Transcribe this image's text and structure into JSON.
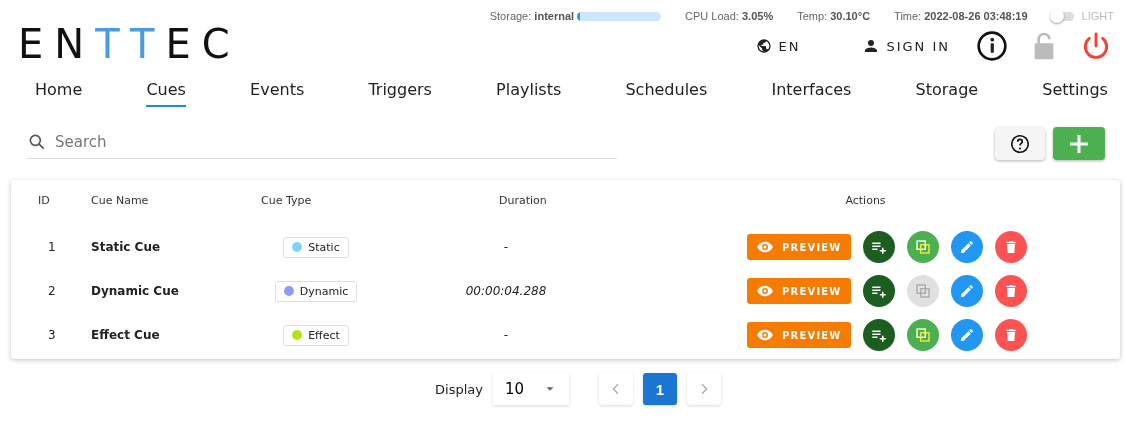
{
  "status": {
    "storage": {
      "label": "Storage:",
      "value": "internal",
      "level": 0.03
    },
    "cpu_label": "CPU Load:",
    "cpu_value": "3.05%",
    "temp_label": "Temp:",
    "temp_value": "30.10°C",
    "time_label": "Time:",
    "time_value": "2022-08-26 03:48:19",
    "theme_toggle": {
      "label": "LIGHT",
      "on": false
    }
  },
  "logo": [
    {
      "text": "EN",
      "accent": false
    },
    {
      "text": "TT",
      "accent": true
    },
    {
      "text": "EC",
      "accent": false
    }
  ],
  "header_actions": {
    "language": "EN",
    "sign_in": "SIGN IN"
  },
  "nav": [
    {
      "label": "Home",
      "selected": false
    },
    {
      "label": "Cues",
      "selected": true
    },
    {
      "label": "Events",
      "selected": false
    },
    {
      "label": "Triggers",
      "selected": false
    },
    {
      "label": "Playlists",
      "selected": false
    },
    {
      "label": "Schedules",
      "selected": false
    },
    {
      "label": "Interfaces",
      "selected": false
    },
    {
      "label": "Storage",
      "selected": false
    },
    {
      "label": "Settings",
      "selected": false
    }
  ],
  "search": {
    "placeholder": "Search"
  },
  "table": {
    "columns": [
      "ID",
      "Cue Name",
      "Cue Type",
      "Duration",
      "Actions"
    ],
    "rows": [
      {
        "id": "1",
        "name": "Static Cue",
        "type": "Static",
        "color": "#7fd3fb",
        "duration": "-",
        "preview": "PREVIEW",
        "copy_disabled": false
      },
      {
        "id": "2",
        "name": "Dynamic Cue",
        "type": "Dynamic",
        "color": "#8c9cf8",
        "duration": "00:00:04.288",
        "preview": "PREVIEW",
        "copy_disabled": true
      },
      {
        "id": "3",
        "name": "Effect Cue",
        "type": "Effect",
        "color": "#b2e314",
        "duration": "-",
        "preview": "PREVIEW",
        "copy_disabled": false
      }
    ]
  },
  "pagination": {
    "label": "Display",
    "page_size": "10",
    "pages": [
      {
        "label": "1",
        "selected": true
      }
    ]
  }
}
